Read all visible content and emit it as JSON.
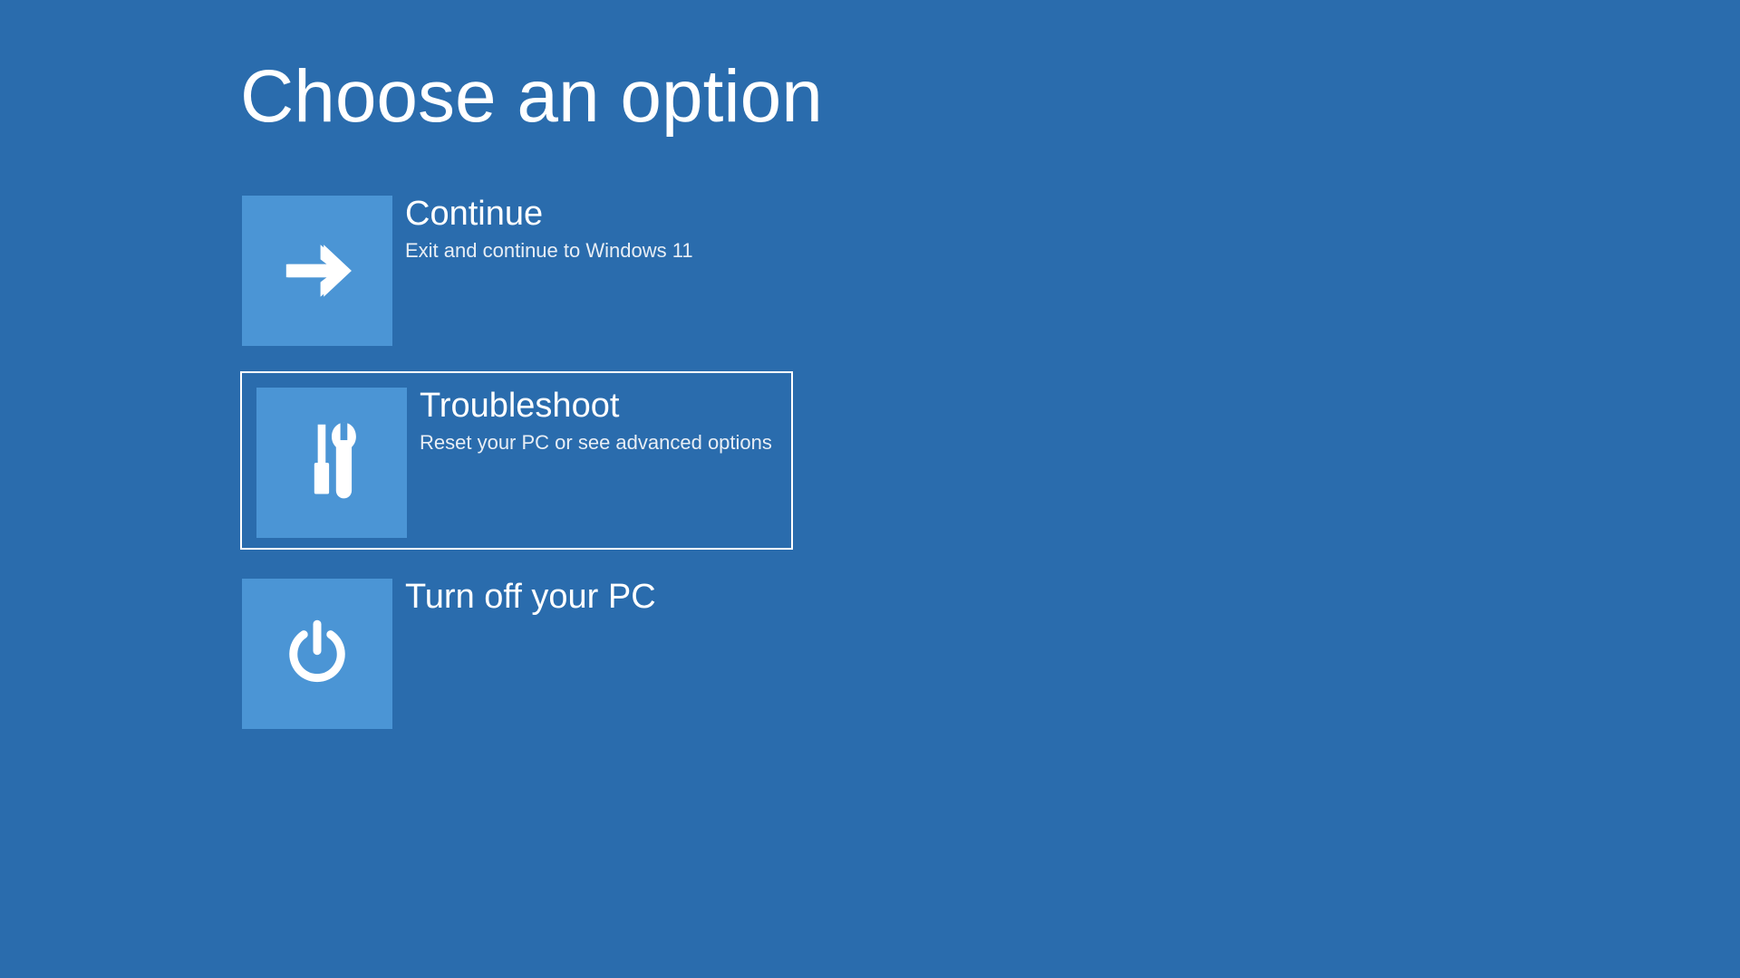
{
  "title": "Choose an option",
  "colors": {
    "background": "#2a6cad",
    "tile": "#4b95d5",
    "text": "#ffffff"
  },
  "options": {
    "continue": {
      "title": "Continue",
      "desc": "Exit and continue to Windows 11",
      "icon": "arrow-right-icon",
      "selected": false
    },
    "troubleshoot": {
      "title": "Troubleshoot",
      "desc": "Reset your PC or see advanced options",
      "icon": "tools-icon",
      "selected": true
    },
    "turnoff": {
      "title": "Turn off your PC",
      "desc": "",
      "icon": "power-icon",
      "selected": false
    }
  }
}
